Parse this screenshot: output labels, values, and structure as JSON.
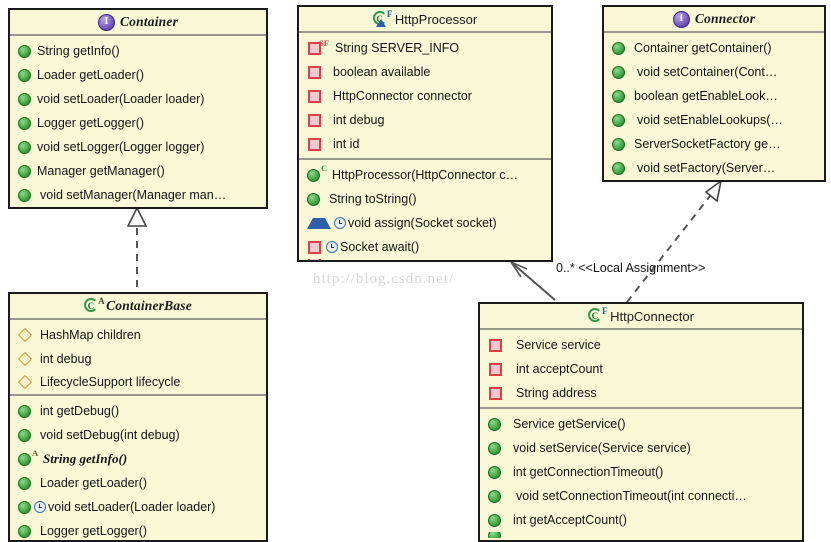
{
  "diagram": {
    "title": "UML Class Diagram - Tomcat Connector / Container",
    "watermark": "http://blog.csdn.net/",
    "colors": {
      "box_fill": "#f9f9d7",
      "box_border": "#1a1a1a",
      "separator": "#9a9a8c",
      "public_marker": "#3da33d",
      "private_marker": "#d8424a",
      "protected_marker": "#2f5fa8",
      "attribute_marker": "#d79b2a",
      "interface_icon": "#7b5fc4",
      "class_icon": "#2f9a4a",
      "watermark_text": "#d8d8d8"
    }
  },
  "classes": {
    "container": {
      "name": "Container",
      "stereotype": "interface",
      "icon": "interface-icon",
      "badge": "",
      "italic": true,
      "attributes": [],
      "methods": [
        {
          "marker": "public",
          "badge": "",
          "sync": false,
          "italic": false,
          "text": "String getInfo()"
        },
        {
          "marker": "public",
          "badge": "",
          "sync": false,
          "italic": false,
          "text": "Loader getLoader()"
        },
        {
          "marker": "public",
          "badge": "",
          "sync": false,
          "italic": false,
          "text": "void setLoader(Loader loader)"
        },
        {
          "marker": "public",
          "badge": "",
          "sync": false,
          "italic": false,
          "text": "Logger getLogger()"
        },
        {
          "marker": "public",
          "badge": "",
          "sync": false,
          "italic": false,
          "text": "void setLogger(Logger logger)"
        },
        {
          "marker": "public",
          "badge": "",
          "sync": false,
          "italic": false,
          "text": "Manager getManager()"
        },
        {
          "marker": "public",
          "badge": "",
          "sync": false,
          "italic": false,
          "text": "void setManager(Manager man…"
        }
      ]
    },
    "container_base": {
      "name": "ContainerBase",
      "stereotype": "abstract-class",
      "icon": "class-icon",
      "badge": "A",
      "italic": true,
      "attributes": [
        {
          "marker": "attribute",
          "badge": "",
          "sync": false,
          "italic": false,
          "text": "HashMap children"
        },
        {
          "marker": "attribute",
          "badge": "",
          "sync": false,
          "italic": false,
          "text": "int debug"
        },
        {
          "marker": "attribute",
          "badge": "",
          "sync": false,
          "italic": false,
          "text": "LifecycleSupport lifecycle"
        }
      ],
      "methods": [
        {
          "marker": "public",
          "badge": "",
          "sync": false,
          "italic": false,
          "text": "int getDebug()"
        },
        {
          "marker": "public",
          "badge": "",
          "sync": false,
          "italic": false,
          "text": "void setDebug(int debug)"
        },
        {
          "marker": "public",
          "badge": "A",
          "sync": false,
          "italic": true,
          "text": "String getInfo()"
        },
        {
          "marker": "public",
          "badge": "",
          "sync": false,
          "italic": false,
          "text": "Loader getLoader()"
        },
        {
          "marker": "public",
          "badge": "",
          "sync": true,
          "italic": false,
          "text": "void setLoader(Loader loader)"
        },
        {
          "marker": "public",
          "badge": "",
          "sync": false,
          "italic": false,
          "text": "Logger getLogger()"
        }
      ]
    },
    "http_processor": {
      "name": "HttpProcessor",
      "stereotype": "final-class",
      "icon": "class-icon",
      "badge": "F",
      "italic": false,
      "attributes": [
        {
          "marker": "private",
          "badge": "SF",
          "sync": false,
          "italic": false,
          "text": "String SERVER_INFO"
        },
        {
          "marker": "private",
          "badge": "",
          "sync": false,
          "italic": false,
          "text": "boolean available"
        },
        {
          "marker": "private",
          "badge": "",
          "sync": false,
          "italic": false,
          "text": "HttpConnector connector"
        },
        {
          "marker": "private",
          "badge": "",
          "sync": false,
          "italic": false,
          "text": "int debug"
        },
        {
          "marker": "private",
          "badge": "",
          "sync": false,
          "italic": false,
          "text": "int id"
        }
      ],
      "methods": [
        {
          "marker": "public",
          "badge": "C",
          "sync": false,
          "italic": false,
          "text": "HttpProcessor(HttpConnector c…"
        },
        {
          "marker": "public",
          "badge": "",
          "sync": false,
          "italic": false,
          "text": "String toString()"
        },
        {
          "marker": "protected",
          "badge": "",
          "sync": true,
          "italic": false,
          "text": "void assign(Socket socket)"
        },
        {
          "marker": "private",
          "badge": "",
          "sync": true,
          "italic": false,
          "text": "Socket await()"
        }
      ]
    },
    "connector": {
      "name": "Connector",
      "stereotype": "interface",
      "icon": "interface-icon",
      "badge": "",
      "italic": true,
      "attributes": [],
      "methods": [
        {
          "marker": "public",
          "badge": "",
          "sync": false,
          "italic": false,
          "text": "Container getContainer()"
        },
        {
          "marker": "public",
          "badge": "",
          "sync": false,
          "italic": false,
          "text": "void setContainer(Cont…"
        },
        {
          "marker": "public",
          "badge": "",
          "sync": false,
          "italic": false,
          "text": "boolean getEnableLook…"
        },
        {
          "marker": "public",
          "badge": "",
          "sync": false,
          "italic": false,
          "text": "void setEnableLookups(…"
        },
        {
          "marker": "public",
          "badge": "",
          "sync": false,
          "italic": false,
          "text": "ServerSocketFactory ge…"
        },
        {
          "marker": "public",
          "badge": "",
          "sync": false,
          "italic": false,
          "text": "void setFactory(Server…"
        }
      ]
    },
    "http_connector": {
      "name": "HttpConnector",
      "stereotype": "final-class",
      "icon": "class-icon",
      "badge": "F",
      "italic": false,
      "attributes": [
        {
          "marker": "private",
          "badge": "",
          "sync": false,
          "italic": false,
          "text": "Service service"
        },
        {
          "marker": "private",
          "badge": "",
          "sync": false,
          "italic": false,
          "text": "int acceptCount"
        },
        {
          "marker": "private",
          "badge": "",
          "sync": false,
          "italic": false,
          "text": "String address"
        }
      ],
      "methods": [
        {
          "marker": "public",
          "badge": "",
          "sync": false,
          "italic": false,
          "text": "Service getService()"
        },
        {
          "marker": "public",
          "badge": "",
          "sync": false,
          "italic": false,
          "text": "void setService(Service service)"
        },
        {
          "marker": "public",
          "badge": "",
          "sync": false,
          "italic": false,
          "text": "int getConnectionTimeout()"
        },
        {
          "marker": "public",
          "badge": "",
          "sync": false,
          "italic": false,
          "text": "void setConnectionTimeout(int connecti…"
        },
        {
          "marker": "public",
          "badge": "",
          "sync": false,
          "italic": false,
          "text": "int getAcceptCount()"
        }
      ]
    }
  },
  "relationships": [
    {
      "name": "containerbase-realizes-container",
      "type": "realization",
      "from": "ContainerBase",
      "to": "Container",
      "label": ""
    },
    {
      "name": "httpconnector-realizes-connector",
      "type": "realization",
      "from": "HttpConnector",
      "to": "Connector",
      "label": ""
    },
    {
      "name": "httpconnector-assigns-httpprocessor",
      "type": "association",
      "from": "HttpConnector",
      "to": "HttpProcessor",
      "label": "0..* <<Local Assignment>>"
    }
  ]
}
